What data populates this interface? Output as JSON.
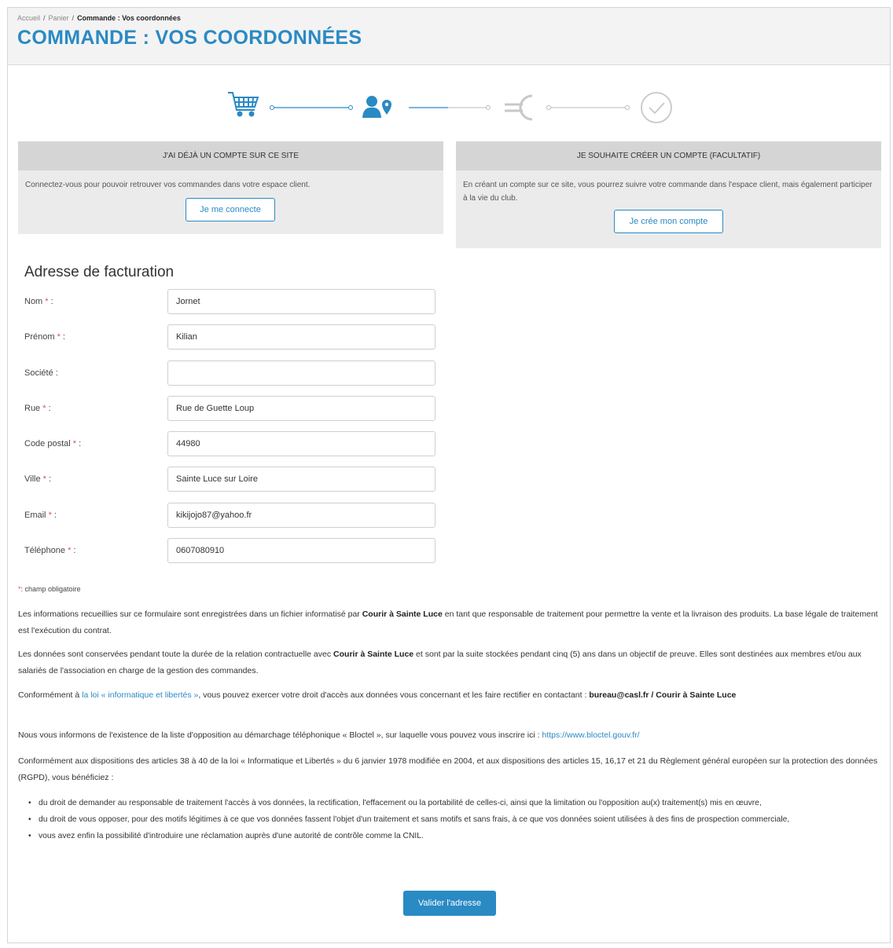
{
  "breadcrumb": {
    "home": "Accueil",
    "sep1": "/",
    "cart": "Panier",
    "sep2": "/",
    "current": "Commande : Vos coordonnées"
  },
  "page_title": "COMMANDE : VOS COORDONNÉES",
  "steps": [
    "cart-icon",
    "user-location-icon",
    "euro-icon",
    "check-circle-icon"
  ],
  "accent_color": "#2a8ac4",
  "login_box": {
    "header": "J'AI DÉJÀ UN COMPTE SUR CE SITE",
    "text": "Connectez-vous pour pouvoir retrouver vos commandes dans votre espace client.",
    "button": "Je me connecte"
  },
  "register_box": {
    "header": "JE SOUHAITE CRÉER UN COMPTE (FACULTATIF)",
    "text": "En créant un compte sur ce site, vous pourrez suivre votre commande dans l'espace client, mais également participer à la vie du club.",
    "button": "Je crée mon compte"
  },
  "billing": {
    "title": "Adresse de facturation",
    "fields": [
      {
        "label": "Nom",
        "required": true,
        "value": "Jornet"
      },
      {
        "label": "Prénom",
        "required": true,
        "value": "Kilian"
      },
      {
        "label": "Société",
        "required": false,
        "value": ""
      },
      {
        "label": "Rue",
        "required": true,
        "value": "Rue de Guette Loup"
      },
      {
        "label": "Code postal",
        "required": true,
        "value": "44980"
      },
      {
        "label": "Ville",
        "required": true,
        "value": "Sainte Luce sur Loire"
      },
      {
        "label": "Email",
        "required": true,
        "value": "kikijojo87@yahoo.fr"
      },
      {
        "label": "Téléphone",
        "required": true,
        "value": "0607080910"
      }
    ],
    "req_mark": "*",
    "colon": " :",
    "required_note": ": champ obligatoire"
  },
  "legal": {
    "p1_a": "Les informations recueillies sur ce formulaire sont enregistrées dans un fichier informatisé par ",
    "p1_b": "Courir à Sainte Luce",
    "p1_c": " en tant que responsable de traitement pour permettre la vente et la livraison des produits. La base légale de traitement est l'exécution du contrat.",
    "p2_a": "Les données sont conservées pendant toute la durée de la relation contractuelle avec ",
    "p2_b": "Courir à Sainte Luce",
    "p2_c": " et sont par la suite stockées pendant cinq (5) ans dans un objectif de preuve. Elles sont destinées aux membres et/ou aux salariés de l'association en charge de la gestion des commandes.",
    "p3_a": "Conformément à ",
    "p3_link": "la loi « informatique et libertés »",
    "p3_c": ", vous pouvez exercer votre droit d'accès aux données vous concernant et les faire rectifier en contactant : ",
    "p3_d": "bureau@casl.fr / Courir à Sainte Luce",
    "p4_a": "Nous vous informons de l'existence de la liste d'opposition au démarchage téléphonique « Bloctel », sur laquelle vous pouvez vous inscrire ici : ",
    "p4_link": "https://www.bloctel.gouv.fr/",
    "p5": "Conformément aux dispositions des articles 38 à 40 de la loi « Informatique et Libertés » du 6 janvier 1978 modifiée en 2004, et aux dispositions des articles 15, 16,17 et 21 du Règlement général européen sur la protection des données (RGPD), vous bénéficiez :",
    "bullets": [
      "du droit de demander au responsable de traitement l'accès à vos données, la rectification, l'effacement ou la portabilité de celles-ci, ainsi que la limitation ou l'opposition au(x) traitement(s) mis en œuvre,",
      "du droit de vous opposer, pour des motifs légitimes à ce que vos données fassent l'objet d'un traitement et sans motifs et sans frais, à ce que vos données soient utilisées à des fins de prospection commerciale,",
      "vous avez enfin la possibilité d'introduire une réclamation auprès d'une autorité de contrôle comme la CNIL."
    ]
  },
  "submit_button": "Valider l'adresse"
}
